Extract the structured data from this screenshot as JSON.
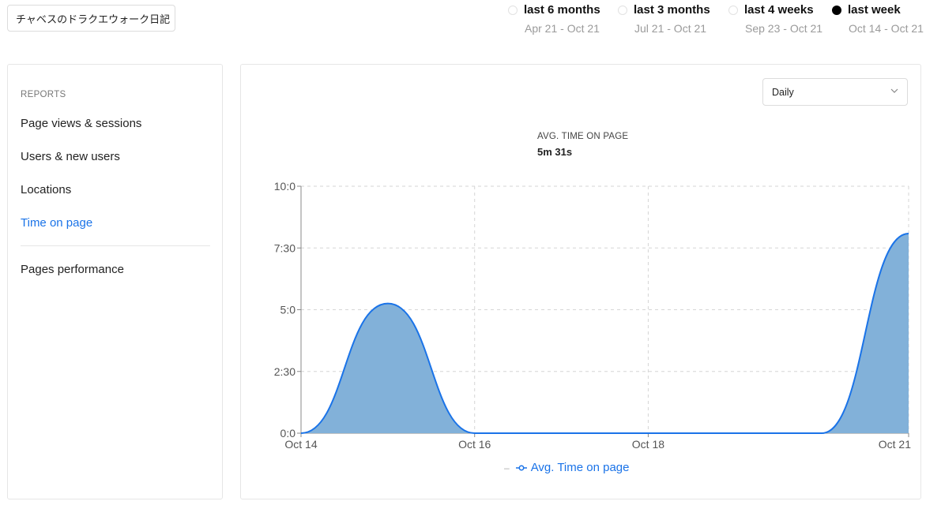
{
  "site_selector": {
    "value": "チャベスのドラクエウォーク日記",
    "icon": "chevron-down-icon"
  },
  "date_ranges": [
    {
      "label": "last 6 months",
      "range": "Apr 21 - Oct 21",
      "selected": false
    },
    {
      "label": "last 3 months",
      "range": "Jul 21 - Oct 21",
      "selected": false
    },
    {
      "label": "last 4 weeks",
      "range": "Sep 23 - Oct 21",
      "selected": false
    },
    {
      "label": "last week",
      "range": "Oct 14 - Oct 21",
      "selected": true
    }
  ],
  "sidebar": {
    "heading": "REPORTS",
    "items": [
      {
        "label": "Page views & sessions",
        "active": false
      },
      {
        "label": "Users & new users",
        "active": false
      },
      {
        "label": "Locations",
        "active": false
      },
      {
        "label": "Time on page",
        "active": true
      },
      {
        "label": "Pages performance",
        "active": false
      }
    ]
  },
  "granularity": {
    "value": "Daily"
  },
  "metric": {
    "title": "AVG. TIME ON PAGE",
    "value": "5m 31s"
  },
  "colors": {
    "accent": "#1a73e8",
    "area_fill": "#82b1d9",
    "line": "#1a73e8"
  },
  "chart_data": {
    "type": "area",
    "title": "AVG. TIME ON PAGE",
    "xlabel": "",
    "ylabel": "",
    "x": [
      "Oct 14",
      "Oct 15",
      "Oct 16",
      "Oct 17",
      "Oct 18",
      "Oct 19",
      "Oct 20",
      "Oct 21"
    ],
    "x_tick_labels": [
      "Oct 14",
      "Oct 16",
      "Oct 18",
      "Oct 21"
    ],
    "y_ticks": [
      0,
      150,
      300,
      450,
      600
    ],
    "y_tick_labels": [
      "0:0",
      "2:30",
      "5:0",
      "7:30",
      "10:0"
    ],
    "ylim": [
      0,
      600
    ],
    "grid": true,
    "legend_position": "bottom",
    "series": [
      {
        "name": "Avg. Time on page",
        "values": [
          0,
          315,
          0,
          0,
          0,
          0,
          0,
          485
        ]
      }
    ]
  },
  "legend": {
    "label": "Avg. Time on page"
  }
}
